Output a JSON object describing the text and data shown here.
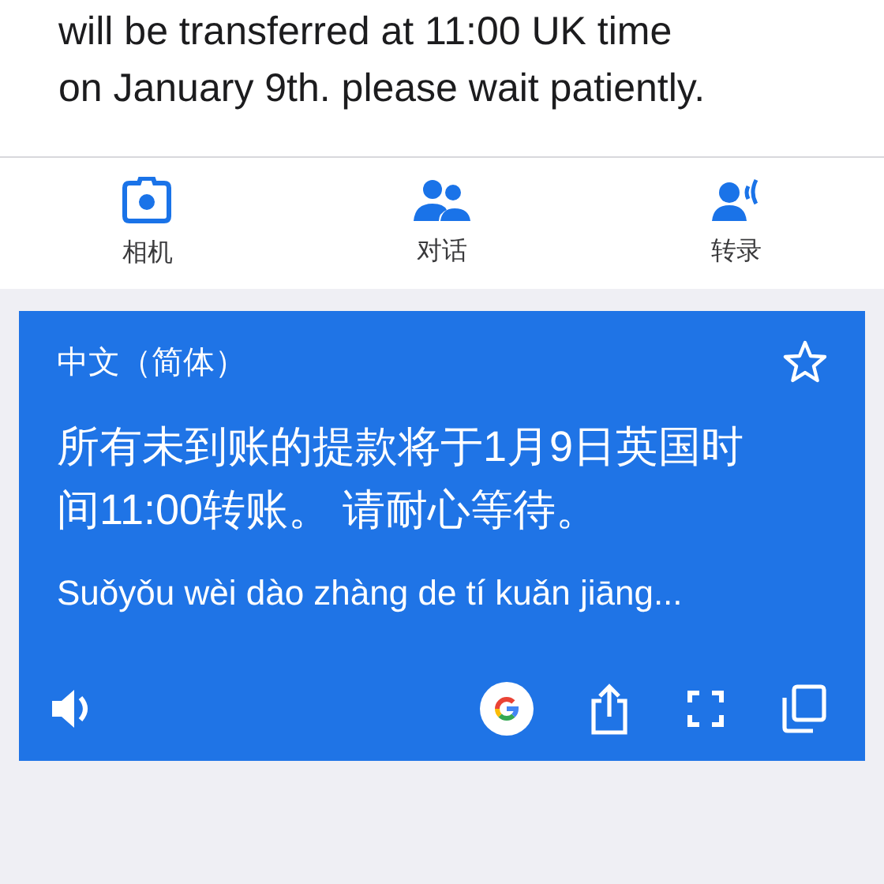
{
  "source_text": [
    "will be transferred at 11:00 UK time",
    "on January 9th. please wait patiently."
  ],
  "modes": [
    {
      "kind": "camera",
      "label": "相机"
    },
    {
      "kind": "conversation",
      "label": "对话"
    },
    {
      "kind": "transcribe",
      "label": "转录"
    }
  ],
  "result": {
    "language": "中文（简体）",
    "starred": false,
    "text": "所有未到账的提款将于1月9日英国时间11:00转账。 请耐心等待。",
    "romanization": "Suǒyǒu wèi dào zhàng de tí kuǎn jiāng..."
  }
}
